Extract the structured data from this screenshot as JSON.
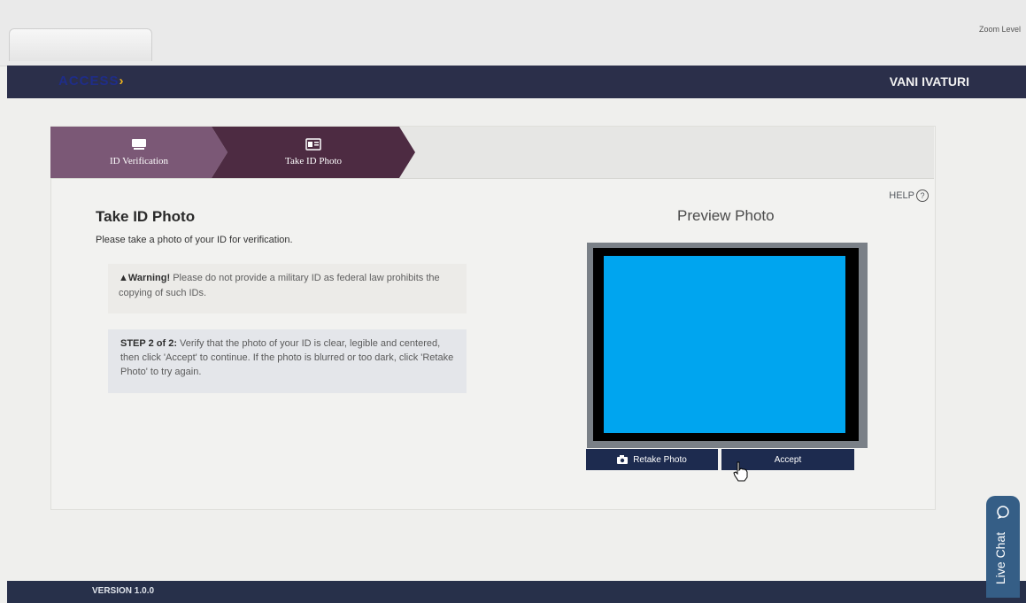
{
  "browser": {
    "zoom_label": "Zoom Level"
  },
  "header": {
    "logo_text": "ACCESS",
    "user_name": "VANI IVATURI"
  },
  "stepper": {
    "steps": [
      {
        "label": "ID Verification",
        "icon": "id-card-icon"
      },
      {
        "label": "Take ID Photo",
        "icon": "photo-id-icon"
      }
    ]
  },
  "help": {
    "label": "HELP",
    "icon": "question-circle-icon"
  },
  "main": {
    "title": "Take ID Photo",
    "subtitle": "Please take a photo of your ID for verification.",
    "warning_prefix": "Warning!",
    "warning_text": " Please do not provide a military ID as federal law prohibits the copying of such IDs.",
    "step_prefix": "STEP 2 of 2:",
    "step_text": " Verify that the photo of your ID is clear, legible and centered, then click 'Accept' to continue. If the photo is blurred or too dark, click 'Retake Photo' to try again."
  },
  "preview": {
    "title": "Preview Photo",
    "retake_label": "Retake Photo",
    "accept_label": "Accept",
    "photo_color": "#00a5ef"
  },
  "footer": {
    "version": "VERSION 1.0.0"
  },
  "live_chat": {
    "label": "Live Chat",
    "icon": "chat-bubble-icon"
  },
  "colors": {
    "header_bg": "#2b2f4a",
    "step_active": "#4d2b42",
    "step_done": "#7b5876",
    "button_bg": "#1d2b4f",
    "live_chat_bg": "#355e86"
  }
}
